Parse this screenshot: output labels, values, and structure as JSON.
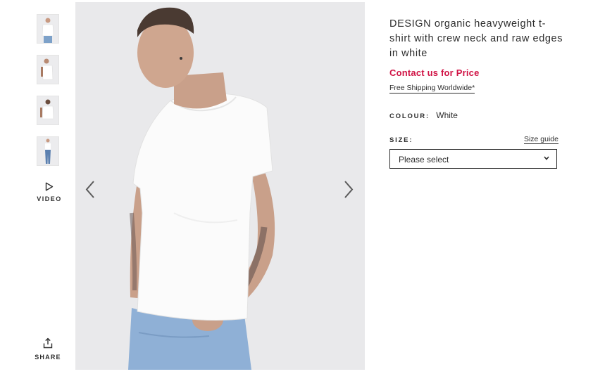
{
  "thumbnails": [
    {
      "alt": "front view"
    },
    {
      "alt": "side view"
    },
    {
      "alt": "back view"
    },
    {
      "alt": "full length view"
    }
  ],
  "video": {
    "label": "VIDEO",
    "icon": "play-icon"
  },
  "share": {
    "label": "SHARE",
    "icon": "share-icon"
  },
  "gallery": {
    "prev_icon": "chevron-left-icon",
    "next_icon": "chevron-right-icon"
  },
  "product": {
    "title": "DESIGN organic heavyweight t-shirt with crew neck and raw edges in white",
    "price": "Contact us for Price",
    "shipping": "Free Shipping Worldwide*",
    "colour_label": "COLOUR:",
    "colour_value": "White",
    "size_label": "SIZE:",
    "size_guide": "Size guide",
    "size_selected": "Please select"
  },
  "colors": {
    "price": "#d01345",
    "text": "#2d2d2d",
    "image_bg": "#e9e9eb"
  }
}
